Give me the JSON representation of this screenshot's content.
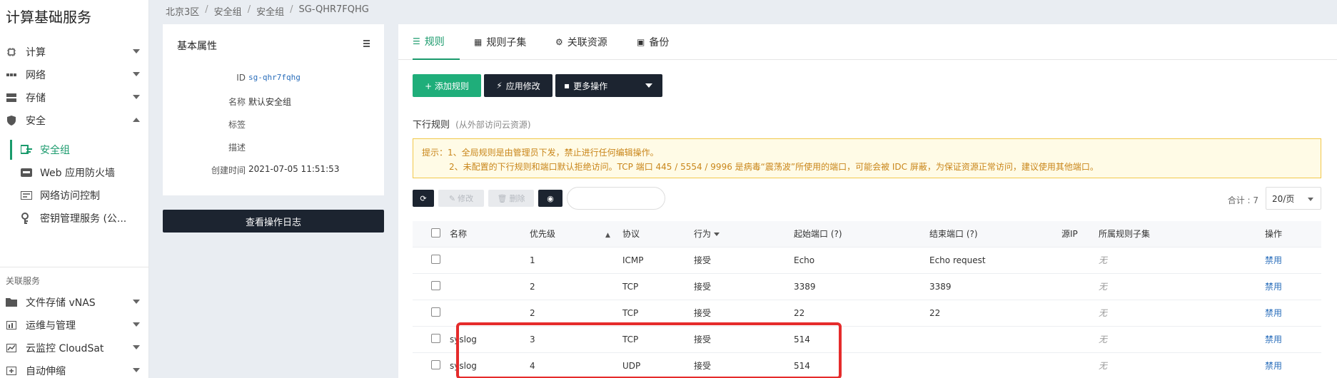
{
  "app": {
    "title": "计算基础服务"
  },
  "sidebar": {
    "items": [
      {
        "label": "计算",
        "icon": "chip-icon"
      },
      {
        "label": "网络",
        "icon": "network-icon"
      },
      {
        "label": "存储",
        "icon": "storage-icon"
      },
      {
        "label": "安全",
        "icon": "shield-icon"
      }
    ],
    "security_sub": [
      {
        "label": "安全组",
        "icon": "security-group-icon",
        "active": true
      },
      {
        "label": "Web 应用防火墙",
        "icon": "firewall-icon"
      },
      {
        "label": "网络访问控制",
        "icon": "acl-icon"
      },
      {
        "label": "密钥管理服务 (公...",
        "icon": "key-icon"
      }
    ],
    "related_label": "关联服务",
    "related": [
      {
        "label": "文件存储 vNAS",
        "icon": "folder-icon"
      },
      {
        "label": "运维与管理",
        "icon": "ops-icon"
      },
      {
        "label": "云监控 CloudSat",
        "icon": "monitor-icon"
      },
      {
        "label": "自动伸缩",
        "icon": "scale-icon"
      }
    ]
  },
  "breadcrumb": [
    "北京3区",
    "安全组",
    "安全组",
    "SG-QHR7FQHG"
  ],
  "props": {
    "title": "基本属性",
    "rows": [
      {
        "label": "ID",
        "value": "sg-qhr7fqhg"
      },
      {
        "label": "名称",
        "value": "默认安全组"
      },
      {
        "label": "标签",
        "value": ""
      },
      {
        "label": "描述",
        "value": ""
      },
      {
        "label": "创建时间",
        "value": "2021-07-05 11:51:53"
      }
    ],
    "log_button": "查看操作日志"
  },
  "tabs": [
    {
      "label": "规则",
      "icon": "list-icon"
    },
    {
      "label": "规则子集",
      "icon": "grid-icon"
    },
    {
      "label": "关联资源",
      "icon": "gear-icon"
    },
    {
      "label": "备份",
      "icon": "camera-icon"
    }
  ],
  "toolbar": {
    "add_rule": "+ 添加规则",
    "apply": "应用修改",
    "more": "更多操作"
  },
  "rules": {
    "heading": "下行规则",
    "heading_sub": "(从外部访问云资源)",
    "notice_line1": "提示：1、全局规则是由管理员下发，禁止进行任何编辑操作。",
    "notice_line2": "2、未配置的下行规则和端口默认拒绝访问。TCP 端口 445 / 5554 / 9996 是病毒“震荡波”所使用的端口，可能会被 IDC 屏蔽，为保证资源正常访问，建议使用其他端口。",
    "edit_label": "修改",
    "delete_label": "删除",
    "total": "合计 : 7",
    "page_size": "20/页"
  },
  "table": {
    "headers": [
      "名称",
      "优先级",
      "协议",
      "行为",
      "起始端口 (?)",
      "结束端口 (?)",
      "源IP",
      "所属规则子集",
      "操作"
    ],
    "rows": [
      {
        "name": "",
        "priority": "1",
        "protocol": "ICMP",
        "action": "接受",
        "start": "Echo",
        "end": "Echo request",
        "src": "",
        "subset": "无",
        "op": "禁用"
      },
      {
        "name": "",
        "priority": "2",
        "protocol": "TCP",
        "action": "接受",
        "start": "3389",
        "end": "3389",
        "src": "",
        "subset": "无",
        "op": "禁用"
      },
      {
        "name": "",
        "priority": "2",
        "protocol": "TCP",
        "action": "接受",
        "start": "22",
        "end": "22",
        "src": "",
        "subset": "无",
        "op": "禁用"
      },
      {
        "name": "syslog",
        "priority": "3",
        "protocol": "TCP",
        "action": "接受",
        "start": "514",
        "end": "",
        "src": "",
        "subset": "无",
        "op": "禁用"
      },
      {
        "name": "syslog",
        "priority": "4",
        "protocol": "UDP",
        "action": "接受",
        "start": "514",
        "end": "",
        "src": "",
        "subset": "无",
        "op": "禁用"
      }
    ]
  }
}
